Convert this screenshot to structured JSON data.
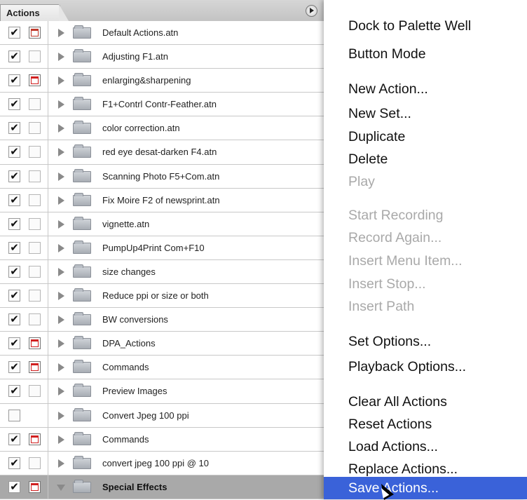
{
  "palette": {
    "tab_label": "Actions",
    "rows": [
      {
        "name": "Default Actions.atn",
        "checked": true,
        "dialog": "dark",
        "open": false
      },
      {
        "name": "Adjusting F1.atn",
        "checked": true,
        "dialog": "off",
        "open": false
      },
      {
        "name": "enlarging&sharpening",
        "checked": true,
        "dialog": "red",
        "open": false
      },
      {
        "name": "F1+Contrl Contr-Feather.atn",
        "checked": true,
        "dialog": "off",
        "open": false
      },
      {
        "name": "color correction.atn",
        "checked": true,
        "dialog": "off",
        "open": false
      },
      {
        "name": "red eye desat-darken F4.atn",
        "checked": true,
        "dialog": "off",
        "open": false
      },
      {
        "name": "Scanning Photo F5+Com.atn",
        "checked": true,
        "dialog": "off",
        "open": false
      },
      {
        "name": "Fix Moire F2 of newsprint.atn",
        "checked": true,
        "dialog": "off",
        "open": false
      },
      {
        "name": "vignette.atn",
        "checked": true,
        "dialog": "off",
        "open": false
      },
      {
        "name": "PumpUp4Print Com+F10",
        "checked": true,
        "dialog": "off",
        "open": false
      },
      {
        "name": "size changes",
        "checked": true,
        "dialog": "off",
        "open": false
      },
      {
        "name": "Reduce ppi or size or both",
        "checked": true,
        "dialog": "off",
        "open": false
      },
      {
        "name": "BW conversions",
        "checked": true,
        "dialog": "off",
        "open": false
      },
      {
        "name": "DPA_Actions",
        "checked": true,
        "dialog": "red",
        "open": false
      },
      {
        "name": "Commands",
        "checked": true,
        "dialog": "red",
        "open": false
      },
      {
        "name": "Preview Images",
        "checked": true,
        "dialog": "off",
        "open": false
      },
      {
        "name": "Convert Jpeg 100 ppi",
        "checked": false,
        "dialog": "none",
        "open": false
      },
      {
        "name": "Commands",
        "checked": true,
        "dialog": "red",
        "open": false
      },
      {
        "name": "convert jpeg 100 ppi @ 10",
        "checked": true,
        "dialog": "off",
        "open": false
      },
      {
        "name": "Special Effects",
        "checked": true,
        "dialog": "red",
        "open": true,
        "selected": true
      }
    ]
  },
  "menu": {
    "items": [
      {
        "label": "Dock to Palette Well",
        "enabled": true
      },
      {
        "label": "Button Mode",
        "enabled": true
      },
      {
        "label": "New Action...",
        "enabled": true
      },
      {
        "label": "New Set...",
        "enabled": true
      },
      {
        "label": "Duplicate",
        "enabled": true
      },
      {
        "label": "Delete",
        "enabled": true
      },
      {
        "label": "Play",
        "enabled": false
      },
      {
        "label": "Start Recording",
        "enabled": false
      },
      {
        "label": "Record Again...",
        "enabled": false
      },
      {
        "label": "Insert Menu Item...",
        "enabled": false
      },
      {
        "label": "Insert Stop...",
        "enabled": false
      },
      {
        "label": "Insert Path",
        "enabled": false
      },
      {
        "label": "Set Options...",
        "enabled": true
      },
      {
        "label": "Playback Options...",
        "enabled": true
      },
      {
        "label": "Clear All Actions",
        "enabled": true
      },
      {
        "label": "Reset Actions",
        "enabled": true
      },
      {
        "label": "Load Actions...",
        "enabled": true
      },
      {
        "label": "Replace Actions...",
        "enabled": true
      },
      {
        "label": "Save Actions...",
        "enabled": true,
        "highlighted": true
      }
    ]
  },
  "colors": {
    "menu_highlight": "#3a62d9",
    "disabled_text": "#a9a9a9",
    "dialog_red": "#d12020"
  }
}
